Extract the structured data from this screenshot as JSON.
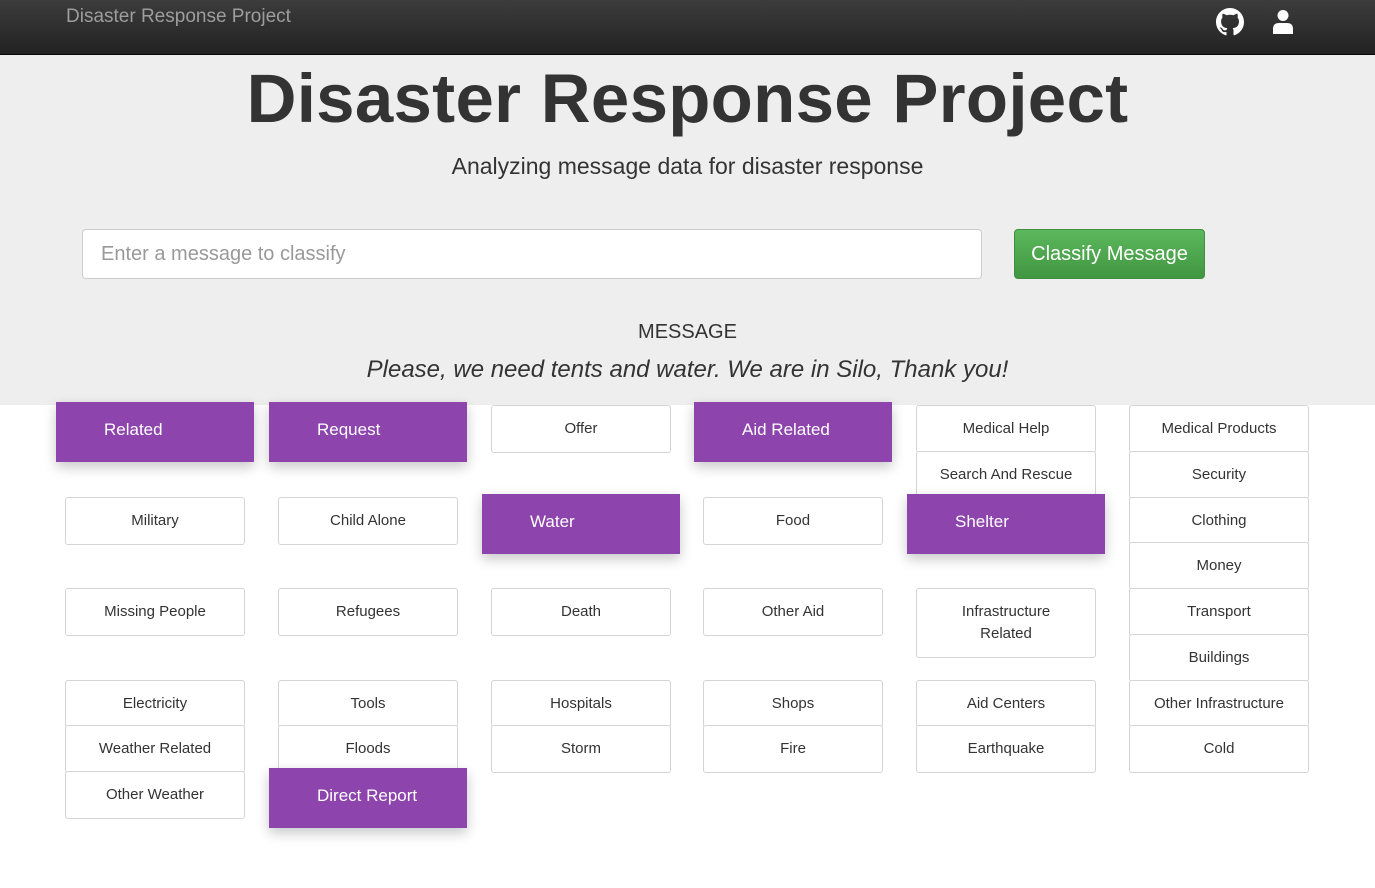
{
  "navbar": {
    "brand": "Disaster Response Project",
    "github_icon": "github-icon",
    "user_icon": "user-icon"
  },
  "header": {
    "title": "Disaster Response Project",
    "subtitle": "Analyzing message data for disaster response"
  },
  "form": {
    "placeholder": "Enter a message to classify",
    "button_label": "Classify Message"
  },
  "message": {
    "heading": "MESSAGE",
    "text": "Please, we need tents and water. We are in Silo, Thank you!"
  },
  "colors": {
    "highlight": "#8e44ad",
    "button": "#5cb85c",
    "navbar": "#222222",
    "jumbotron": "#eeeeee"
  },
  "categories": [
    {
      "label": "Related",
      "active": true
    },
    {
      "label": "Request",
      "active": true
    },
    {
      "label": "Offer",
      "active": false
    },
    {
      "label": "Aid Related",
      "active": true
    },
    {
      "label": "Medical Help",
      "active": false
    },
    {
      "label": "Medical Products",
      "active": false
    },
    {
      "label": "Search And Rescue",
      "active": false
    },
    {
      "label": "Security",
      "active": false
    },
    {
      "label": "Military",
      "active": false
    },
    {
      "label": "Child Alone",
      "active": false
    },
    {
      "label": "Water",
      "active": true
    },
    {
      "label": "Food",
      "active": false
    },
    {
      "label": "Shelter",
      "active": true
    },
    {
      "label": "Clothing",
      "active": false
    },
    {
      "label": "Money",
      "active": false
    },
    {
      "label": "Missing People",
      "active": false
    },
    {
      "label": "Refugees",
      "active": false
    },
    {
      "label": "Death",
      "active": false
    },
    {
      "label": "Other Aid",
      "active": false
    },
    {
      "label": "Infrastructure Related",
      "active": false
    },
    {
      "label": "Transport",
      "active": false
    },
    {
      "label": "Buildings",
      "active": false
    },
    {
      "label": "Electricity",
      "active": false
    },
    {
      "label": "Tools",
      "active": false
    },
    {
      "label": "Hospitals",
      "active": false
    },
    {
      "label": "Shops",
      "active": false
    },
    {
      "label": "Aid Centers",
      "active": false
    },
    {
      "label": "Other Infrastructure",
      "active": false
    },
    {
      "label": "Weather Related",
      "active": false
    },
    {
      "label": "Floods",
      "active": false
    },
    {
      "label": "Storm",
      "active": false
    },
    {
      "label": "Fire",
      "active": false
    },
    {
      "label": "Earthquake",
      "active": false
    },
    {
      "label": "Cold",
      "active": false
    },
    {
      "label": "Other Weather",
      "active": false
    },
    {
      "label": "Direct Report",
      "active": true
    }
  ]
}
